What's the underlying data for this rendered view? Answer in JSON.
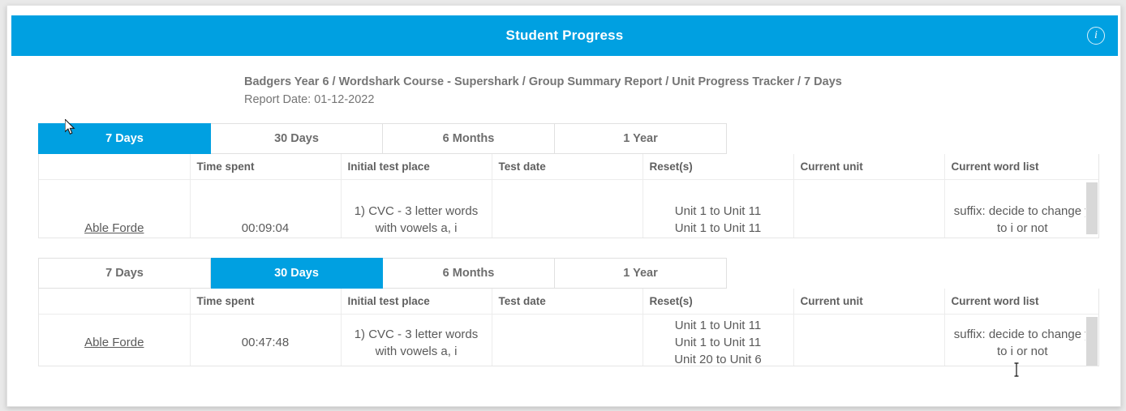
{
  "window": {
    "header_title": "Student Progress",
    "info_icon": "info-circle-icon"
  },
  "report_header": {
    "breadcrumb": "Badgers Year 6 / Wordshark Course - Supershark / Group Summary Report / Unit Progress Tracker / 7 Days",
    "report_date": "Report Date: 01-12-2022"
  },
  "columns": [
    "",
    "Time spent",
    "Initial test place",
    "Test date",
    "Reset(s)",
    "Current unit",
    "Current word list"
  ],
  "tab_labels": [
    "7 Days",
    "30 Days",
    "6 Months",
    "1 Year"
  ],
  "sections": [
    {
      "id": "section-7-days",
      "active_tab": "7 Days",
      "tabs": [
        {
          "label": "7 Days",
          "active": true
        },
        {
          "label": "30 Days",
          "active": false
        },
        {
          "label": "6 Months",
          "active": false
        },
        {
          "label": "1 Year",
          "active": false
        }
      ],
      "rows": [
        {
          "student": "Able Forde",
          "time_spent": "00:09:04",
          "initial_test_place": [
            "1) CVC - 3 letter words",
            "with vowels a, i"
          ],
          "test_date": [],
          "resets": [
            "Unit 1 to Unit 11",
            "Unit 1 to Unit 11"
          ],
          "current_unit": [],
          "current_word_list": [
            "suffix: decide to change y",
            "to i or not"
          ]
        }
      ]
    },
    {
      "id": "section-30-days",
      "active_tab": "30 Days",
      "tabs": [
        {
          "label": "7 Days",
          "active": false
        },
        {
          "label": "30 Days",
          "active": true
        },
        {
          "label": "6 Months",
          "active": false
        },
        {
          "label": "1 Year",
          "active": false
        }
      ],
      "rows": [
        {
          "student": "Able Forde",
          "time_spent": "00:47:48",
          "initial_test_place": [
            "1) CVC - 3 letter words",
            "with vowels a, i"
          ],
          "test_date": [],
          "resets": [
            "Unit 1 to Unit 11",
            "Unit 1 to Unit 11",
            "Unit 20 to Unit 6"
          ],
          "current_unit": [],
          "current_word_list": [
            "suffix: decide to change y",
            "to i or not"
          ]
        }
      ]
    }
  ],
  "colors": {
    "accent": "#00a0e1",
    "text": "#5a5a5a",
    "header_text": "#757575",
    "border": "#e6e6e6",
    "scrollbar": "#d8d8d8"
  },
  "cursors": {
    "arrow_position": "7 Days tab, section 1",
    "ibeam_position": "Current word list cell, section 2"
  }
}
